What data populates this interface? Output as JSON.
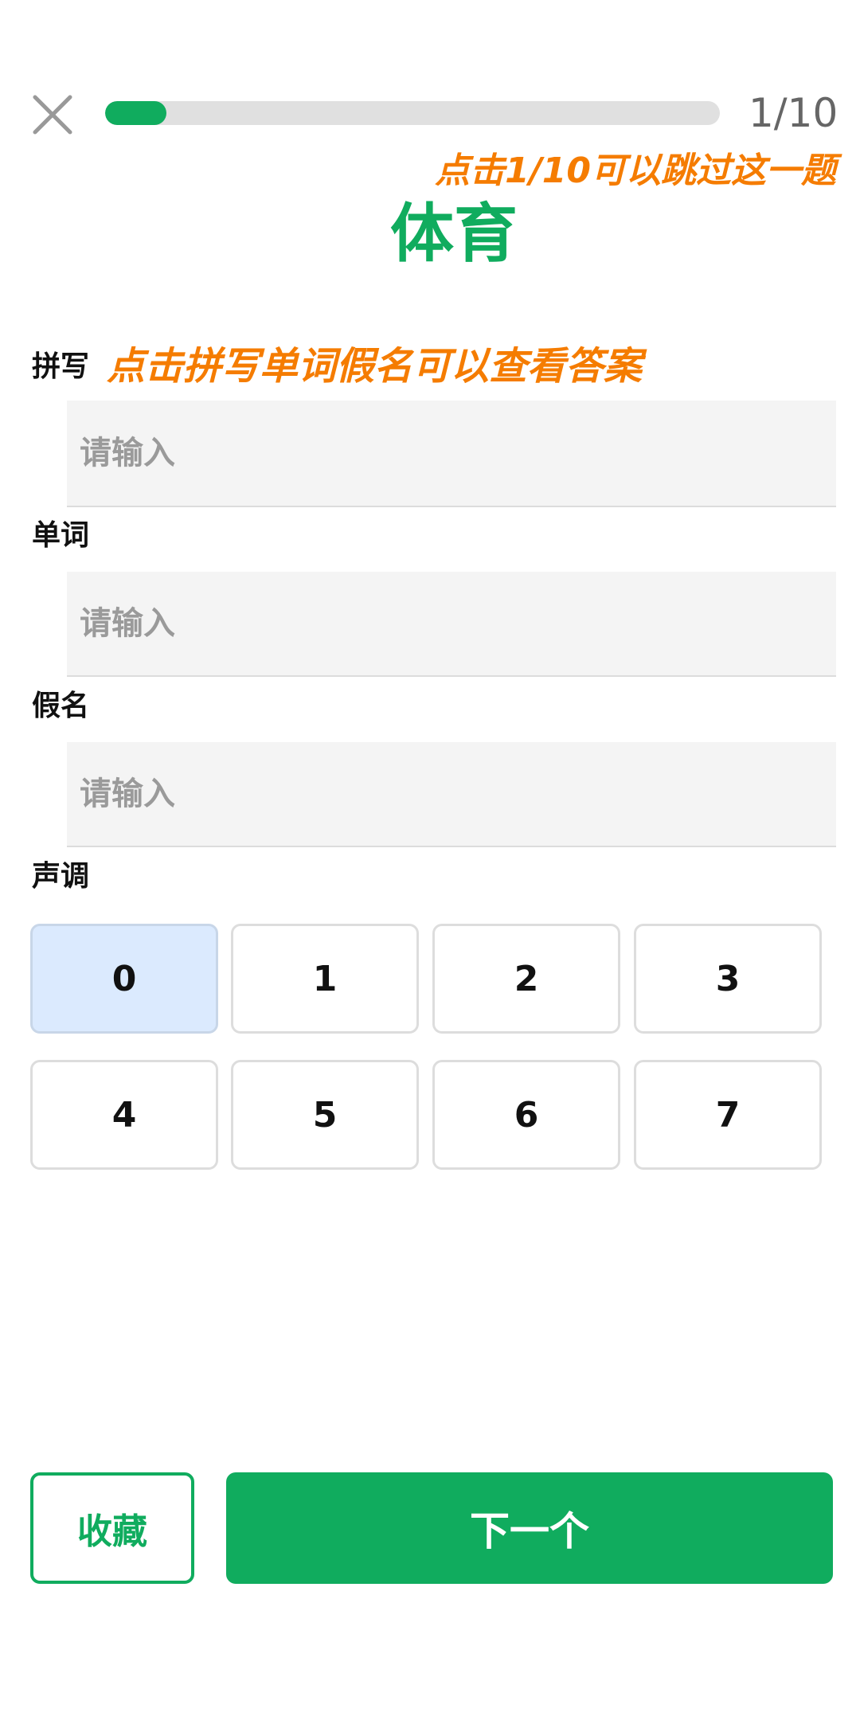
{
  "header": {
    "close_icon": "close-icon",
    "progress": {
      "current": 1,
      "total": 10,
      "fraction": 0.1
    },
    "counter_text": "1/10"
  },
  "hints": {
    "skip": "点击1/10可以跳过这一题",
    "reveal": "点击拼写单词假名可以查看答案"
  },
  "word": "体育",
  "fields": {
    "spelling": {
      "label": "拼写",
      "placeholder": "请输入",
      "value": ""
    },
    "word": {
      "label": "单词",
      "placeholder": "请输入",
      "value": ""
    },
    "kana": {
      "label": "假名",
      "placeholder": "请输入",
      "value": ""
    }
  },
  "tones": {
    "label": "声调",
    "options": [
      "0",
      "1",
      "2",
      "3",
      "4",
      "5",
      "6",
      "7"
    ],
    "selected": "0"
  },
  "actions": {
    "favorite_label": "收藏",
    "next_label": "下一个"
  },
  "colors": {
    "primary": "#10ac5e",
    "hint": "#f57c00",
    "track": "#e0e0e0",
    "selected_tone": "#dbeafe",
    "input_bg": "#f4f4f4"
  }
}
